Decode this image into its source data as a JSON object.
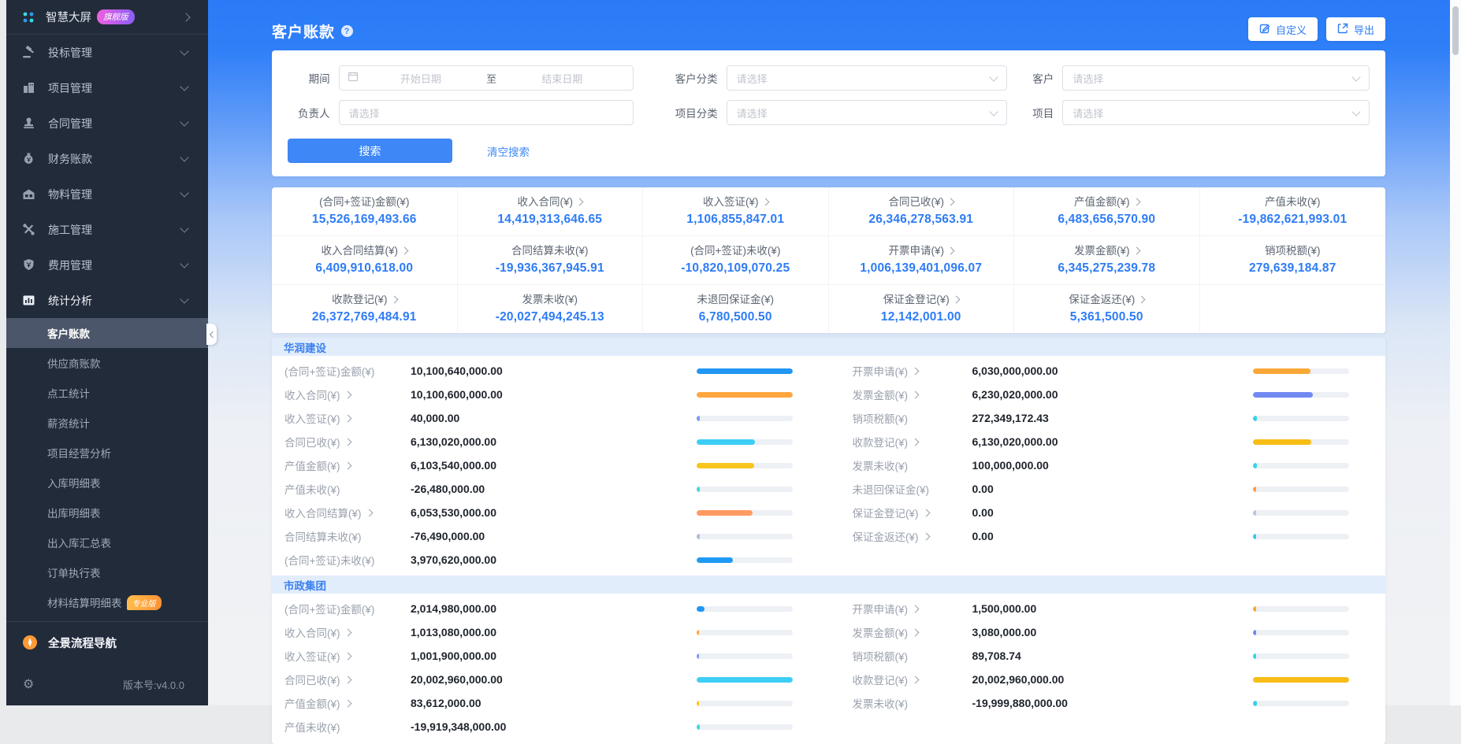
{
  "sidebar": {
    "logo": {
      "label": "智慧大屏",
      "badge": "旗舰版"
    },
    "menu": [
      {
        "label": "投标管理",
        "icon": "bid"
      },
      {
        "label": "项目管理",
        "icon": "project"
      },
      {
        "label": "合同管理",
        "icon": "contract"
      },
      {
        "label": "财务账款",
        "icon": "finance"
      },
      {
        "label": "物料管理",
        "icon": "material"
      },
      {
        "label": "施工管理",
        "icon": "construction"
      },
      {
        "label": "费用管理",
        "icon": "expense"
      },
      {
        "label": "统计分析",
        "icon": "stats",
        "active": true
      }
    ],
    "submenu": [
      {
        "label": "客户账款",
        "active": true
      },
      {
        "label": "供应商账款"
      },
      {
        "label": "点工统计"
      },
      {
        "label": "薪资统计"
      },
      {
        "label": "项目经营分析"
      },
      {
        "label": "入库明细表"
      },
      {
        "label": "出库明细表"
      },
      {
        "label": "出入库汇总表"
      },
      {
        "label": "订单执行表"
      },
      {
        "label": "材料结算明细表",
        "badge": "专业版"
      }
    ],
    "footer_nav": "全景流程导航",
    "version": "版本号:v4.0.0"
  },
  "header": {
    "title": "客户账款",
    "customize": "自定义",
    "export": "导出"
  },
  "filters": {
    "period_label": "期间",
    "start_placeholder": "开始日期",
    "to_label": "至",
    "end_placeholder": "结束日期",
    "customer_category_label": "客户分类",
    "customer_label": "客户",
    "owner_label": "负责人",
    "project_category_label": "项目分类",
    "project_label": "项目",
    "select_placeholder": "请选择",
    "search": "搜索",
    "clear": "清空搜索"
  },
  "summary": {
    "rows": [
      [
        {
          "label": "(合同+签证)金额(¥)",
          "arrow": false,
          "value": "15,526,169,493.66"
        },
        {
          "label": "收入合同(¥)",
          "arrow": true,
          "value": "14,419,313,646.65"
        },
        {
          "label": "收入签证(¥)",
          "arrow": true,
          "value": "1,106,855,847.01"
        },
        {
          "label": "合同已收(¥)",
          "arrow": true,
          "value": "26,346,278,563.91"
        },
        {
          "label": "产值金额(¥)",
          "arrow": true,
          "value": "6,483,656,570.90"
        },
        {
          "label": "产值未收(¥)",
          "arrow": false,
          "value": "-19,862,621,993.01"
        }
      ],
      [
        {
          "label": "收入合同结算(¥)",
          "arrow": true,
          "value": "6,409,910,618.00"
        },
        {
          "label": "合同结算未收(¥)",
          "arrow": false,
          "value": "-19,936,367,945.91"
        },
        {
          "label": "(合同+签证)未收(¥)",
          "arrow": false,
          "value": "-10,820,109,070.25"
        },
        {
          "label": "开票申请(¥)",
          "arrow": true,
          "value": "1,006,139,401,096.07"
        },
        {
          "label": "发票金额(¥)",
          "arrow": true,
          "value": "6,345,275,239.78"
        },
        {
          "label": "销项税额(¥)",
          "arrow": false,
          "value": "279,639,184.87"
        }
      ],
      [
        {
          "label": "收款登记(¥)",
          "arrow": true,
          "value": "26,372,769,484.91"
        },
        {
          "label": "发票未收(¥)",
          "arrow": false,
          "value": "-20,027,494,245.13"
        },
        {
          "label": "未退回保证金(¥)",
          "arrow": false,
          "value": "6,780,500.50"
        },
        {
          "label": "保证金登记(¥)",
          "arrow": true,
          "value": "12,142,001.00"
        },
        {
          "label": "保证金返还(¥)",
          "arrow": true,
          "value": "5,361,500.50"
        },
        {
          "label": "",
          "arrow": false,
          "value": ""
        }
      ]
    ]
  },
  "companies": [
    {
      "name": "华润建设",
      "left": [
        {
          "label": "(合同+签证)金额(¥)",
          "arrow": false,
          "value": "10,100,640,000.00",
          "color": "#2196f3",
          "pct": 100
        },
        {
          "label": "收入合同(¥)",
          "arrow": true,
          "value": "10,100,600,000.00",
          "color": "#ffa63e",
          "pct": 100
        },
        {
          "label": "收入签证(¥)",
          "arrow": true,
          "value": "40,000.00",
          "color": "#7c9bf5",
          "pct": 4
        },
        {
          "label": "合同已收(¥)",
          "arrow": true,
          "value": "6,130,020,000.00",
          "color": "#3ecef5",
          "pct": 61
        },
        {
          "label": "产值金额(¥)",
          "arrow": true,
          "value": "6,103,540,000.00",
          "color": "#f7c51e",
          "pct": 60
        },
        {
          "label": "产值未收(¥)",
          "arrow": false,
          "value": "-26,480,000.00",
          "color": "#3ed8d2",
          "pct": 4
        },
        {
          "label": "收入合同结算(¥)",
          "arrow": true,
          "value": "6,053,530,000.00",
          "color": "#ff9b61",
          "pct": 59
        },
        {
          "label": "合同结算未收(¥)",
          "arrow": false,
          "value": "-76,490,000.00",
          "color": "#aebdd6",
          "pct": 4
        },
        {
          "label": "(合同+签证)未收(¥)",
          "arrow": false,
          "value": "3,970,620,000.00",
          "color": "#1e9af5",
          "pct": 38
        }
      ],
      "right": [
        {
          "label": "开票申请(¥)",
          "arrow": true,
          "value": "6,030,000,000.00",
          "color": "#f8a836",
          "pct": 60
        },
        {
          "label": "发票金额(¥)",
          "arrow": true,
          "value": "6,230,020,000.00",
          "color": "#7289f2",
          "pct": 62
        },
        {
          "label": "销项税额(¥)",
          "arrow": false,
          "value": "272,349,172.43",
          "color": "#35d3e8",
          "pct": 4
        },
        {
          "label": "收款登记(¥)",
          "arrow": true,
          "value": "6,130,020,000.00",
          "color": "#f7bd16",
          "pct": 61
        },
        {
          "label": "发票未收(¥)",
          "arrow": false,
          "value": "100,000,000.00",
          "color": "#35d3e8",
          "pct": 4
        },
        {
          "label": "未退回保证金(¥)",
          "arrow": false,
          "value": "0.00",
          "color": "#ff9d4d",
          "pct": 3
        },
        {
          "label": "保证金登记(¥)",
          "arrow": true,
          "value": "0.00",
          "color": "#b9c4d8",
          "pct": 3
        },
        {
          "label": "保证金返还(¥)",
          "arrow": true,
          "value": "0.00",
          "color": "#35c8f0",
          "pct": 3
        }
      ]
    },
    {
      "name": "市政集团",
      "left": [
        {
          "label": "(合同+签证)金额(¥)",
          "arrow": false,
          "value": "2,014,980,000.00",
          "color": "#2196f3",
          "pct": 9
        },
        {
          "label": "收入合同(¥)",
          "arrow": true,
          "value": "1,013,080,000.00",
          "color": "#ffa63e",
          "pct": 3
        },
        {
          "label": "收入签证(¥)",
          "arrow": true,
          "value": "1,001,900,000.00",
          "color": "#7c9bf5",
          "pct": 3
        },
        {
          "label": "合同已收(¥)",
          "arrow": true,
          "value": "20,002,960,000.00",
          "color": "#3ecef5",
          "pct": 100
        },
        {
          "label": "产值金额(¥)",
          "arrow": true,
          "value": "83,612,000.00",
          "color": "#f7c51e",
          "pct": 3
        },
        {
          "label": "产值未收(¥)",
          "arrow": false,
          "value": "-19,919,348,000.00",
          "color": "#3ed8d2",
          "pct": 4
        }
      ],
      "right": [
        {
          "label": "开票申请(¥)",
          "arrow": true,
          "value": "1,500,000.00",
          "color": "#f8a836",
          "pct": 3
        },
        {
          "label": "发票金额(¥)",
          "arrow": true,
          "value": "3,080,000.00",
          "color": "#7289f2",
          "pct": 3
        },
        {
          "label": "销项税额(¥)",
          "arrow": false,
          "value": "89,708.74",
          "color": "#35d3e8",
          "pct": 3
        },
        {
          "label": "收款登记(¥)",
          "arrow": true,
          "value": "20,002,960,000.00",
          "color": "#f7bd16",
          "pct": 100
        },
        {
          "label": "发票未收(¥)",
          "arrow": false,
          "value": "-19,999,880,000.00",
          "color": "#35d3e8",
          "pct": 4
        }
      ]
    }
  ]
}
